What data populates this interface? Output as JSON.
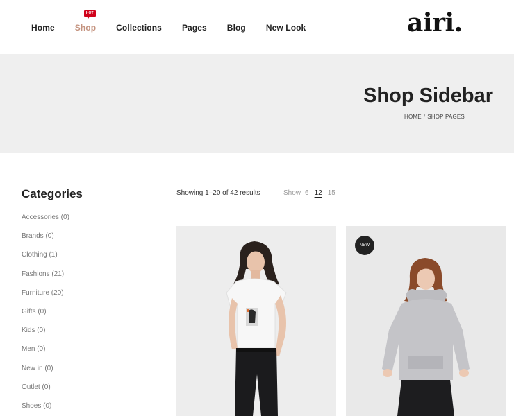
{
  "header": {
    "nav": [
      {
        "label": "Home"
      },
      {
        "label": "Shop",
        "badge": "HOT",
        "active": true
      },
      {
        "label": "Collections"
      },
      {
        "label": "Pages"
      },
      {
        "label": "Blog"
      },
      {
        "label": "New Look"
      }
    ],
    "logo": "airi."
  },
  "banner": {
    "title": "Shop Sidebar",
    "breadcrumb": [
      "HOME",
      "SHOP PAGES"
    ]
  },
  "sidebar": {
    "title": "Categories",
    "categories": [
      {
        "label": "Accessories (0)"
      },
      {
        "label": "Brands (0)"
      },
      {
        "label": "Clothing (1)"
      },
      {
        "label": "Fashions (21)"
      },
      {
        "label": "Furniture (20)"
      },
      {
        "label": "Gifts (0)"
      },
      {
        "label": "Kids (0)"
      },
      {
        "label": "Men (0)"
      },
      {
        "label": "New in (0)"
      },
      {
        "label": "Outlet (0)"
      },
      {
        "label": "Shoes (0)"
      }
    ]
  },
  "toolbar": {
    "results": "Showing 1–20 of 42 results",
    "show_label": "Show",
    "show_options": [
      "6",
      "12",
      "15"
    ],
    "show_selected": "12"
  },
  "products": [
    {
      "badge": ""
    },
    {
      "badge": "NEW"
    }
  ],
  "colors": {
    "accent": "#c4937f",
    "hot_badge": "#d0021b",
    "banner_bg": "#efefef"
  }
}
